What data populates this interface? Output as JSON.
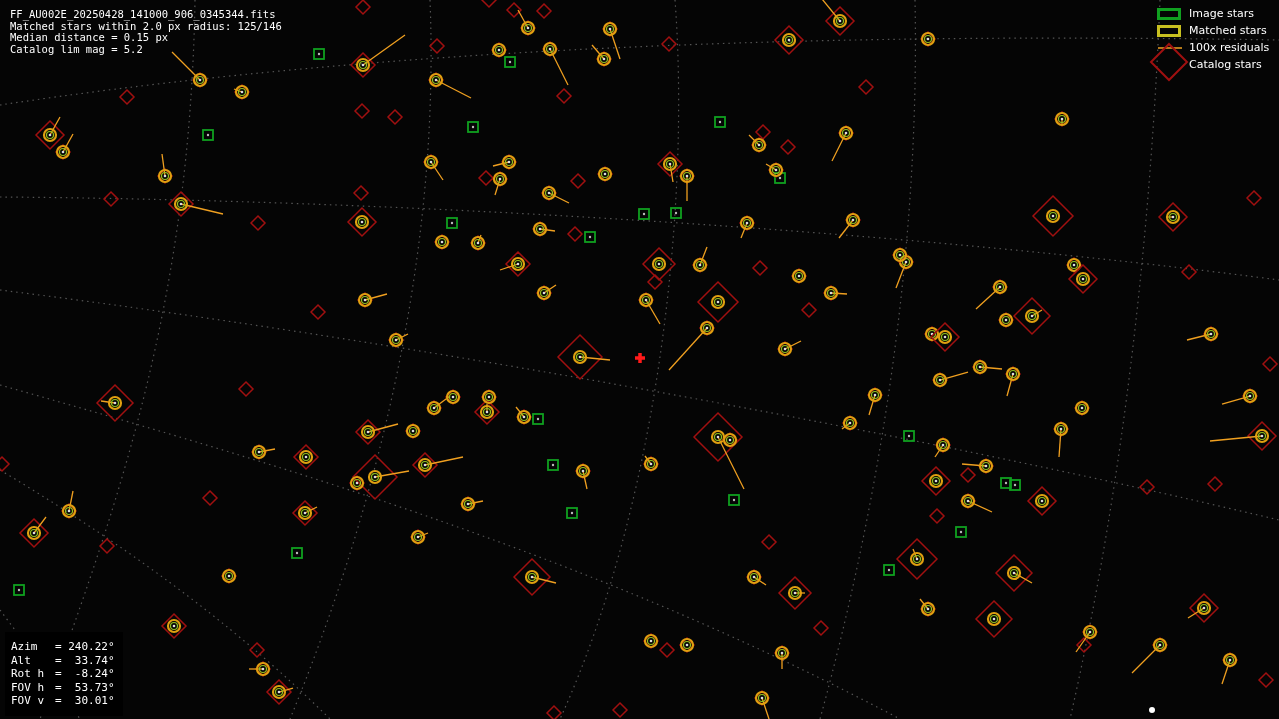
{
  "info": {
    "lines": [
      "FF_AU002E_20250428_141000_906_0345344.fits",
      "Matched stars within 2.0 px radius: 125/146",
      "Median distance = 0.15 px",
      "Catalog lim mag = 5.2"
    ]
  },
  "legend": [
    {
      "kind": "image",
      "label": "Image stars"
    },
    {
      "kind": "matched",
      "label": "Matched stars"
    },
    {
      "kind": "residual",
      "label": "100x residuals"
    },
    {
      "kind": "catalog",
      "label": "Catalog stars"
    }
  ],
  "pointing": [
    {
      "label": "Azim",
      "value": "= 240.22°"
    },
    {
      "label": "Alt",
      "value": "=  33.74°"
    },
    {
      "label": "Rot h",
      "value": "=  -8.24°"
    },
    {
      "label": "FOV h",
      "value": "=  53.73°"
    },
    {
      "label": "FOV v",
      "value": "=  30.01°"
    }
  ]
}
